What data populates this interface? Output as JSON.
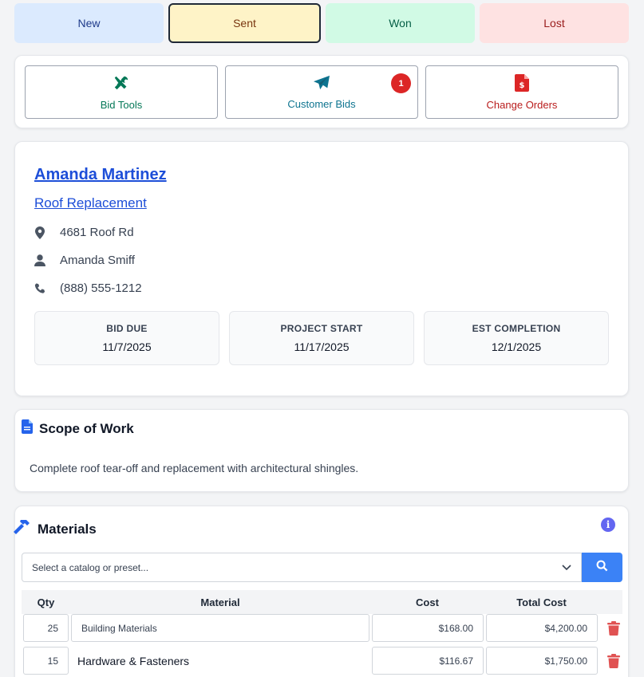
{
  "status_tabs": [
    {
      "label": "New"
    },
    {
      "label": "Sent",
      "selected": true
    },
    {
      "label": "Won"
    },
    {
      "label": "Lost"
    }
  ],
  "actions": {
    "bid_tools": {
      "label": "Bid Tools",
      "icon": "tools-icon"
    },
    "customer_bids": {
      "label": "Customer Bids",
      "icon": "paper-plane-icon",
      "badge": "1"
    },
    "change_orders": {
      "label": "Change Orders",
      "icon": "dollar-file-icon"
    }
  },
  "client": {
    "name": "Amanda Martinez",
    "project": "Roof Replacement",
    "address": "4681 Roof Rd",
    "contact": "Amanda Smiff",
    "phone": "(888) 555-1212"
  },
  "dates": [
    {
      "label": "BID DUE",
      "value": "11/7/2025"
    },
    {
      "label": "PROJECT START",
      "value": "11/17/2025"
    },
    {
      "label": "EST COMPLETION",
      "value": "12/1/2025"
    }
  ],
  "scope": {
    "title": "Scope of Work",
    "text": "Complete roof tear-off and replacement with architectural shingles."
  },
  "materials": {
    "title": "Materials",
    "select_placeholder": "Select a catalog or preset...",
    "columns": {
      "qty": "Qty",
      "material": "Material",
      "cost": "Cost",
      "total": "Total Cost"
    },
    "rows": [
      {
        "qty": "25",
        "material": "Building Materials",
        "cost": "$168.00",
        "total": "$4,200.00"
      },
      {
        "qty": "15",
        "material": "Hardware & Fasteners",
        "cost": "$116.67",
        "total": "$1,750.00"
      }
    ]
  },
  "colors": {
    "accent": "#3b82f6",
    "link": "#1d4ed8",
    "danger": "#dc2626"
  }
}
